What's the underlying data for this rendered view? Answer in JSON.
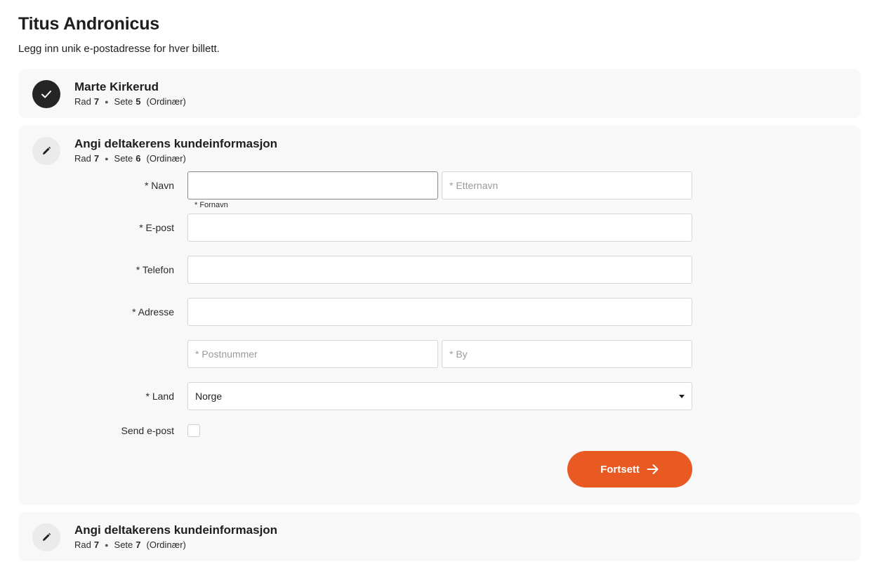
{
  "page": {
    "title": "Titus Andronicus",
    "subtitle": "Legg inn unik e-postadresse for hver billett."
  },
  "tickets": [
    {
      "title": "Marte Kirkerud",
      "row_label": "Rad",
      "row": "7",
      "seat_label": "Sete",
      "seat": "5",
      "kind": "(Ordinær)",
      "icon": "check-icon"
    },
    {
      "title": "Angi deltakerens kundeinformasjon",
      "row_label": "Rad",
      "row": "7",
      "seat_label": "Sete",
      "seat": "6",
      "kind": "(Ordinær)",
      "icon": "pencil-icon"
    },
    {
      "title": "Angi deltakerens kundeinformasjon",
      "row_label": "Rad",
      "row": "7",
      "seat_label": "Sete",
      "seat": "7",
      "kind": "(Ordinær)",
      "icon": "pencil-icon"
    }
  ],
  "form": {
    "name_label": "* Navn",
    "first_name_value": "",
    "first_name_hint": "* Fornavn",
    "last_name_placeholder": "* Etternavn",
    "email_label": "* E-post",
    "email_value": "",
    "phone_label": "* Telefon",
    "phone_value": "",
    "address_label": "* Adresse",
    "address_value": "",
    "postal_placeholder": "* Postnummer",
    "city_placeholder": "* By",
    "country_label": "* Land",
    "country_value": "Norge",
    "send_email_label": "Send e-post",
    "send_email_checked": false,
    "continue_label": "Fortsett"
  },
  "colors": {
    "accent": "#e85a22",
    "card_background": "#f8f8f8",
    "done_circle": "#252525",
    "edit_circle": "#ebebeb"
  }
}
